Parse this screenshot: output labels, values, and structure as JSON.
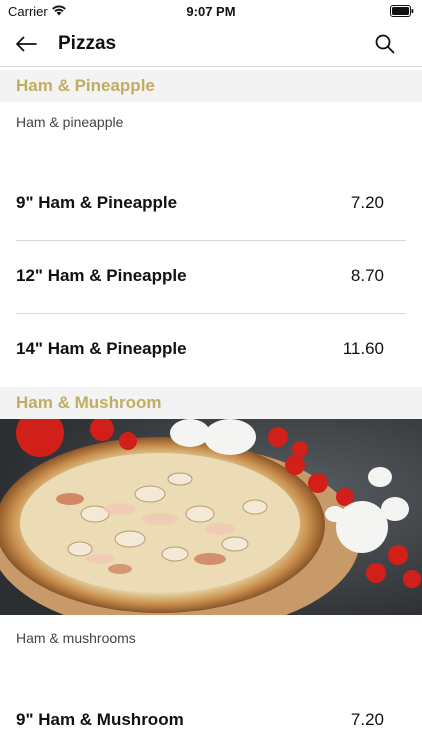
{
  "status_bar": {
    "carrier": "Carrier",
    "time": "9:07 PM",
    "wifi_icon": "wifi-icon",
    "battery_icon": "battery-icon"
  },
  "nav": {
    "title": "Pizzas",
    "back_icon": "arrow-left-icon",
    "search_icon": "search-icon"
  },
  "colors": {
    "section_title": "#bfae62",
    "section_bg": "#f3f3f3",
    "divider": "#d8d8d8"
  },
  "sections": [
    {
      "title": "Ham & Pineapple",
      "description": "Ham & pineapple",
      "items": [
        {
          "name": "9\" Ham & Pineapple",
          "price": "7.20"
        },
        {
          "name": "12\" Ham & Pineapple",
          "price": "8.70"
        },
        {
          "name": "14\" Ham & Pineapple",
          "price": "11.60"
        }
      ]
    },
    {
      "title": "Ham & Mushroom",
      "image": "pizza-photo",
      "description": "Ham & mushrooms",
      "items": [
        {
          "name": "9\" Ham & Mushroom",
          "price": "7.20"
        }
      ]
    }
  ]
}
